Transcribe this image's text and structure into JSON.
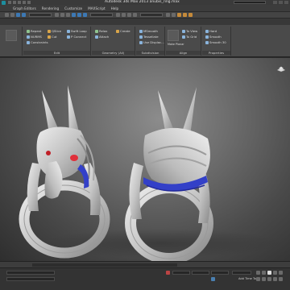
{
  "window": {
    "title": "Autodesk 3ds Max  2013      anubis_ring.max"
  },
  "menu": {
    "items": [
      "Graph Editors",
      "Rendering",
      "Customize",
      "MAXScript",
      "Help"
    ]
  },
  "ribbon": {
    "groups": [
      {
        "label": "Edit",
        "items": [
          "Repeat",
          "NURMS",
          "Constraints",
          "QSlice",
          "Cut",
          "Swift Loop",
          "P Connect"
        ]
      },
      {
        "label": "Geometry (All)",
        "items": [
          "Relax",
          "Attach",
          "Create"
        ]
      },
      {
        "label": "Subdivision",
        "items": [
          "MSmooth",
          "Tessellate",
          "Use Displac..."
        ]
      },
      {
        "label": "Align",
        "items": [
          "Make Planar",
          "To View",
          "To Grid"
        ]
      },
      {
        "label": "Properties",
        "items": [
          "Hard",
          "Smooth",
          "Smooth 30"
        ]
      }
    ]
  },
  "status": {
    "add_time_tag": "Add Time Tag"
  },
  "colors": {
    "accent_blue": "#3340c8",
    "gem_red": "#e0303a",
    "ring_silver": "#c8c8c8"
  }
}
